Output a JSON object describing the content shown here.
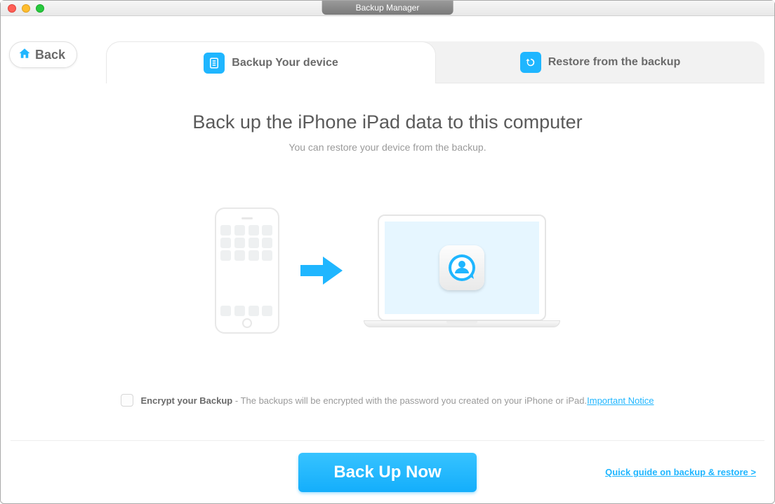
{
  "window": {
    "title": "Backup Manager"
  },
  "header": {
    "back_label": "Back"
  },
  "tabs": {
    "backup_label": "Backup Your device",
    "restore_label": "Restore from the backup"
  },
  "main": {
    "heading": "Back up the iPhone iPad data to this computer",
    "subtitle": "You can restore your device from the backup."
  },
  "encrypt": {
    "bold_label": "Encrypt your Backup",
    "description": " - The backups will be encrypted with the password you created on your iPhone or iPad.",
    "notice_link": "Important Notice"
  },
  "footer": {
    "button_label": "Back Up Now",
    "guide_link": "Quick guide on backup & restore >"
  }
}
